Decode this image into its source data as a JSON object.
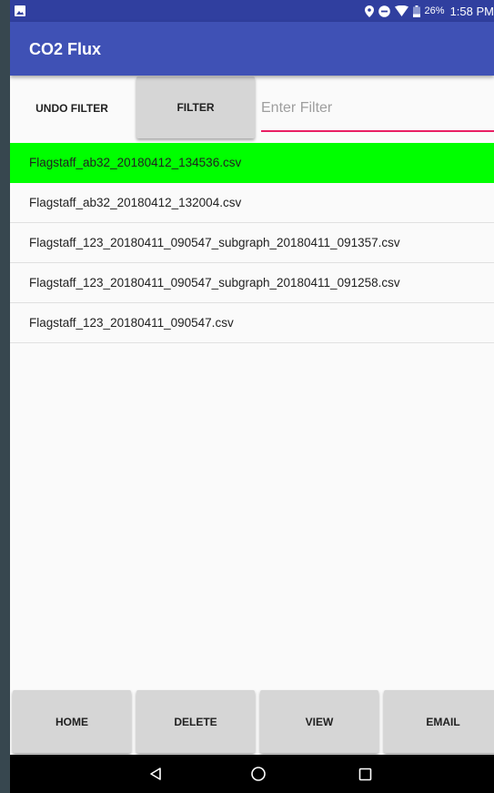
{
  "status_bar": {
    "battery_percent": "26%",
    "time": "1:58 PM",
    "icons": [
      "image-icon",
      "location-icon",
      "do-not-disturb-icon",
      "wifi-icon",
      "battery-icon"
    ]
  },
  "app_bar": {
    "title": "CO2 Flux"
  },
  "filter": {
    "undo_label": "UNDO FILTER",
    "filter_label": "FILTER",
    "placeholder": "Enter Filter",
    "value": ""
  },
  "files": [
    {
      "name": "Flagstaff_ab32_20180412_134536.csv",
      "selected": true
    },
    {
      "name": "Flagstaff_ab32_20180412_132004.csv",
      "selected": false
    },
    {
      "name": "Flagstaff_123_20180411_090547_subgraph_20180411_091357.csv",
      "selected": false
    },
    {
      "name": "Flagstaff_123_20180411_090547_subgraph_20180411_091258.csv",
      "selected": false
    },
    {
      "name": "Flagstaff_123_20180411_090547.csv",
      "selected": false
    }
  ],
  "bottom_buttons": {
    "home": "HOME",
    "delete": "DELETE",
    "view": "VIEW",
    "email": "EMAIL"
  },
  "nav_bar": {
    "icons": [
      "back-icon",
      "home-icon",
      "recents-icon"
    ]
  },
  "colors": {
    "status_bar": "#303f9f",
    "app_bar": "#3f51b5",
    "selected_row": "#00ff00",
    "input_underline": "#e91e63",
    "button": "#d6d6d6"
  }
}
